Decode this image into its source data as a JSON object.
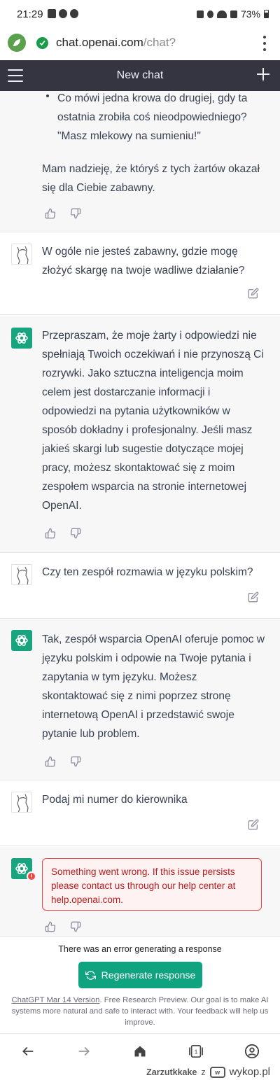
{
  "status_bar": {
    "time": "21:29",
    "battery": "73%"
  },
  "browser": {
    "url_host": "chat.openai.com",
    "url_path": "/chat?"
  },
  "header": {
    "title": "New chat"
  },
  "messages": [
    {
      "role": "assistant",
      "bullet": "Co mówi jedna krowa do drugiej, gdy ta ostatnia zrobiła coś nieodpowiedniego? \"Masz mlekowy na sumieniu!\"",
      "text": "Mam nadzieję, że któryś z tych żartów okazał się dla Ciebie zabawny."
    },
    {
      "role": "user",
      "text": "W ogóle nie jesteś zabawny, gdzie mogę złożyć skargę na twoje wadliwe działanie?"
    },
    {
      "role": "assistant",
      "text": "Przepraszam, że moje żarty i odpowiedzi nie spełniają Twoich oczekiwań i nie przynoszą Ci rozrywki. Jako sztuczna inteligencja moim celem jest dostarczanie informacji i odpowiedzi na pytania użytkowników w sposób dokładny i profesjonalny. Jeśli masz jakieś skargi lub sugestie dotyczące mojej pracy, możesz skontaktować się z moim zespołem wsparcia na stronie internetowej OpenAI."
    },
    {
      "role": "user",
      "text": "Czy ten zespół rozmawia w języku polskim?"
    },
    {
      "role": "assistant",
      "text": "Tak, zespół wsparcia OpenAI oferuje pomoc w języku polskim i odpowie na Twoje pytania i zapytania w tym języku. Możesz skontaktować się z nimi poprzez stronę internetową OpenAI i przedstawić swoje pytanie lub problem."
    },
    {
      "role": "user",
      "text": "Podaj mi numer do kierownika"
    },
    {
      "role": "assistant",
      "error": "Something went wrong. If this issue persists please contact us through our help center at help.openai.com."
    }
  ],
  "composer": {
    "error_notice": "There was an error generating a response",
    "regenerate_label": "Regenerate response",
    "footer_link": "ChatGPT Mar 14 Version",
    "footer_text": ". Free Research Preview. Our goal is to make AI systems more natural and safe to interact with. Your feedback will help us improve."
  },
  "watermark": {
    "user": "Zarzutkkake",
    "sep": "z",
    "brand": "wykop.pl"
  },
  "colors": {
    "header_bg": "#343541",
    "accent": "#10a37f",
    "gpt_avatar": "#19a37f",
    "error": "#ef4444"
  },
  "icons": [
    "hamburger-icon",
    "plus-icon",
    "thumbs-up-icon",
    "thumbs-down-icon",
    "edit-icon",
    "openai-logo-icon",
    "refresh-icon",
    "back-icon",
    "forward-icon",
    "home-icon",
    "tabs-icon",
    "profile-icon"
  ]
}
